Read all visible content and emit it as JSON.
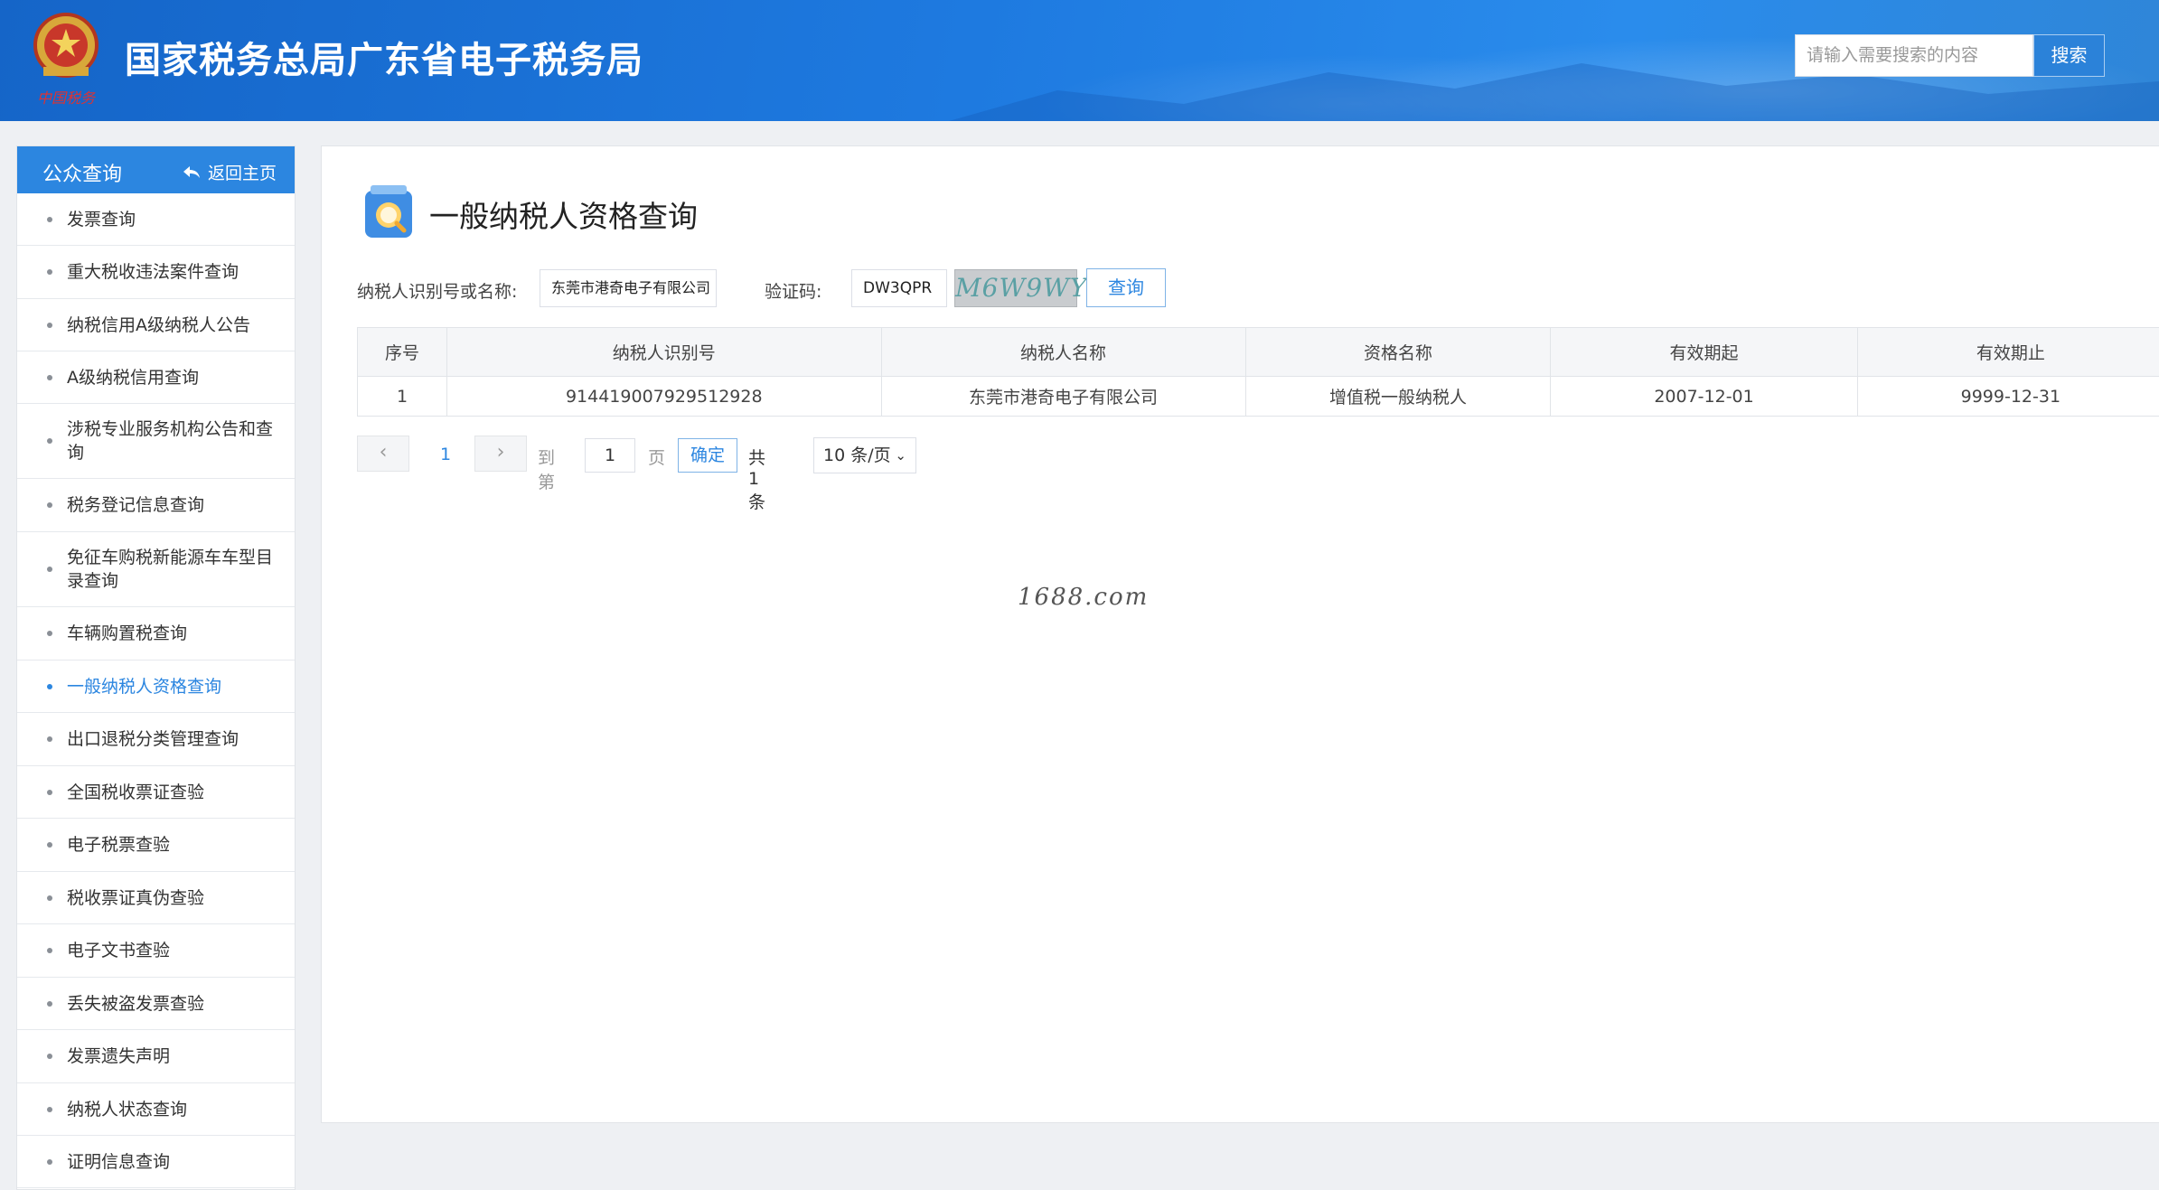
{
  "header": {
    "site_title": "国家税务总局广东省电子税务局",
    "emblem_caption": "中国税务",
    "search_placeholder": "请输入需要搜索的内容",
    "search_button": "搜索"
  },
  "sidebar": {
    "title": "公众查询",
    "back_label": "返回主页",
    "items": [
      {
        "label": "发票查询"
      },
      {
        "label": "重大税收违法案件查询"
      },
      {
        "label": "纳税信用A级纳税人公告"
      },
      {
        "label": "A级纳税信用查询"
      },
      {
        "label": "涉税专业服务机构公告和查询"
      },
      {
        "label": "税务登记信息查询"
      },
      {
        "label": "免征车购税新能源车车型目录查询"
      },
      {
        "label": "车辆购置税查询"
      },
      {
        "label": "一般纳税人资格查询",
        "active": true
      },
      {
        "label": "出口退税分类管理查询"
      },
      {
        "label": "全国税收票证查验"
      },
      {
        "label": "电子税票查验"
      },
      {
        "label": "税收票证真伪查验"
      },
      {
        "label": "电子文书查验"
      },
      {
        "label": "丢失被盗发票查验"
      },
      {
        "label": "发票遗失声明"
      },
      {
        "label": "纳税人状态查询"
      },
      {
        "label": "证明信息查询"
      }
    ]
  },
  "main": {
    "page_title": "一般纳税人资格查询",
    "form": {
      "taxpayer_label": "纳税人识别号或名称:",
      "taxpayer_value": "东莞市港奇电子有限公司",
      "captcha_label": "验证码:",
      "captcha_value": "DW3QPR",
      "captcha_image_text": "M6W9WY",
      "query_button": "查询"
    },
    "table": {
      "headers": [
        "序号",
        "纳税人识别号",
        "纳税人名称",
        "资格名称",
        "有效期起",
        "有效期止"
      ],
      "rows": [
        [
          "1",
          "914419007929512928",
          "东莞市港奇电子有限公司",
          "增值税一般纳税人",
          "2007-12-01",
          "9999-12-31"
        ]
      ]
    },
    "pagination": {
      "current_page": "1",
      "goto_label": "到第",
      "goto_value": "1",
      "page_unit": "页",
      "confirm_button": "确定",
      "total_text": "共 1 条",
      "page_size": "10 条/页"
    }
  },
  "watermark": "1688.com",
  "colors": {
    "header_blue": "#1e7ae0",
    "accent_blue": "#2c86e0",
    "panel_bg": "#ffffff",
    "page_bg": "#eef0f3"
  }
}
